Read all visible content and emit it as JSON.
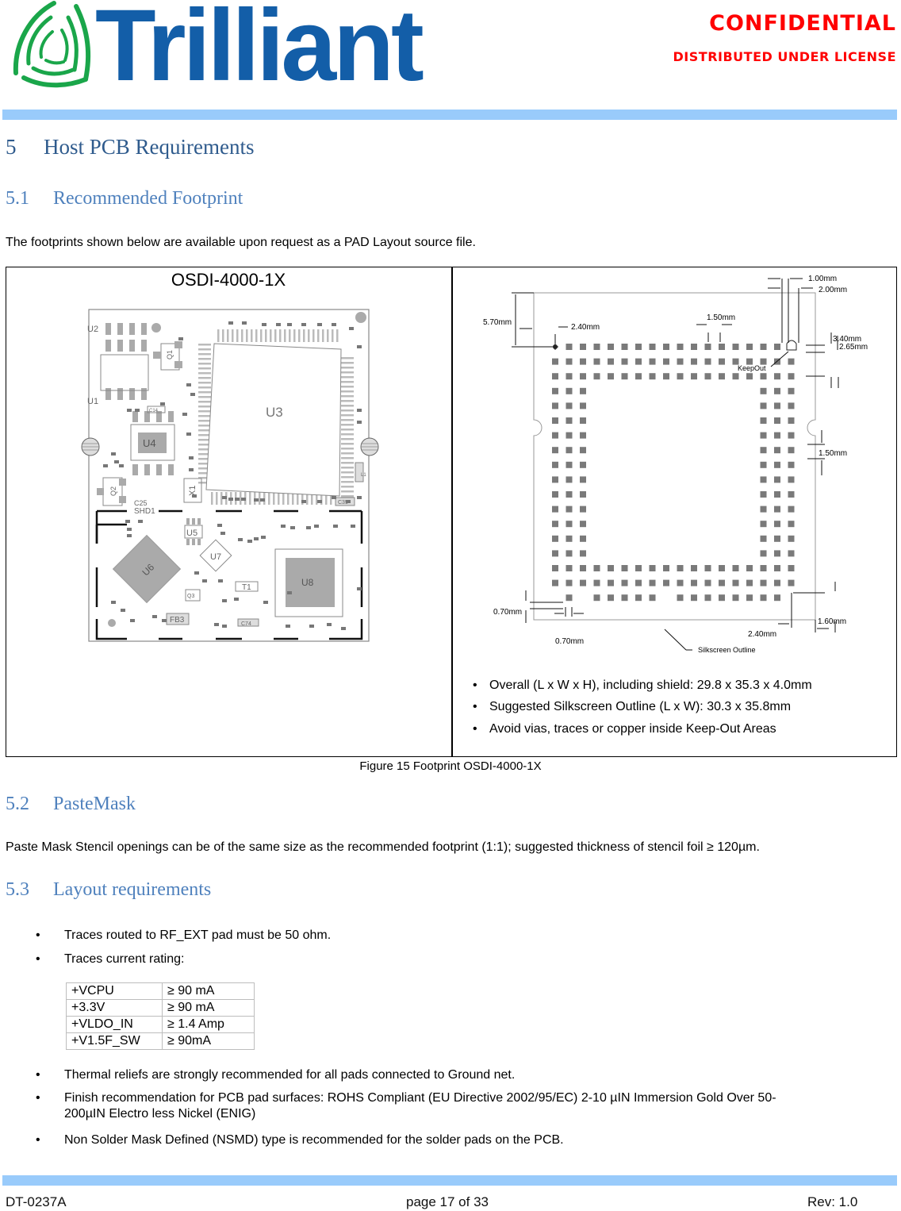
{
  "header": {
    "logo_text": "Trilliant",
    "confidential": "CONFIDENTIAL",
    "distributed": "DISTRIBUTED UNDER LICENSE",
    "brand_colors": {
      "logo_blue": "#135ea8",
      "logo_green": "#1aa64a",
      "confidential_red": "#ff0000",
      "band_blue": "#99cbfb"
    }
  },
  "section5": {
    "num": "5",
    "title": "Host PCB Requirements"
  },
  "section51": {
    "num": "5.1",
    "title": "Recommended Footprint",
    "intro": "The footprints shown below are available upon request as a PAD Layout source file."
  },
  "figure": {
    "left_title": "OSDI-4000-1X",
    "pcb_labels": [
      "U1",
      "U2",
      "U3",
      "U4",
      "U5",
      "U6",
      "U7",
      "U8",
      "Q1",
      "Q2",
      "Q3",
      "X1",
      "T1",
      "L1",
      "FB3",
      "C14",
      "C25",
      "C35",
      "C74",
      "SHD1"
    ],
    "dimensions": {
      "d_100": "1.00mm",
      "d_200": "2.00mm",
      "d_570": "5.70mm",
      "d_240_top": "2.40mm",
      "d_150_top": "1.50mm",
      "d_340": "3.40mm",
      "d_265": "2.65mm",
      "d_150_side": "1.50mm",
      "d_070_v": "0.70mm",
      "d_070_h": "0.70mm",
      "d_160": "1.60mm",
      "d_240_bottom": "2.40mm",
      "keepout": "KeepOut",
      "silkscreen": "Silkscreen Outline"
    },
    "bullets": [
      "Overall (L x W x H), including shield: 29.8 x 35.3 x 4.0mm",
      "Suggested Silkscreen Outline (L x W): 30.3 x 35.8mm",
      "Avoid vias, traces or copper inside Keep-Out Areas"
    ],
    "caption": "Figure 15 Footprint OSDI-4000-1X"
  },
  "section52": {
    "num": "5.2",
    "title": "PasteMask",
    "text": "Paste Mask Stencil openings can be of the same size as the recommended footprint (1:1); suggested thickness of stencil foil ≥ 120µm."
  },
  "section53": {
    "num": "5.3",
    "title": "Layout requirements",
    "bullets_top": [
      "Traces routed to RF_EXT pad must be 50 ohm.",
      "Traces current rating:"
    ],
    "ratings": [
      {
        "net": "+VCPU",
        "value": "≥ 90 mA"
      },
      {
        "net": "+3.3V",
        "value": "≥ 90 mA"
      },
      {
        "net": "+VLDO_IN",
        "value": "≥ 1.4 Amp"
      },
      {
        "net": "+V1.5F_SW",
        "value": "≥ 90mA"
      }
    ],
    "bullets_bottom": [
      "Thermal reliefs are strongly recommended for all pads connected to Ground net.",
      "Finish recommendation for PCB pad surfaces: ROHS Compliant (EU Directive 2002/95/EC) 2-10 µIN Immersion Gold Over 50-",
      "200µIN Electro less Nickel (ENIG)",
      "Non Solder Mask Defined (NSMD) type is recommended for the solder pads on the PCB."
    ]
  },
  "footer": {
    "doc_id": "DT-0237A",
    "page": "page 17 of 33",
    "rev": "Rev: 1.0"
  }
}
